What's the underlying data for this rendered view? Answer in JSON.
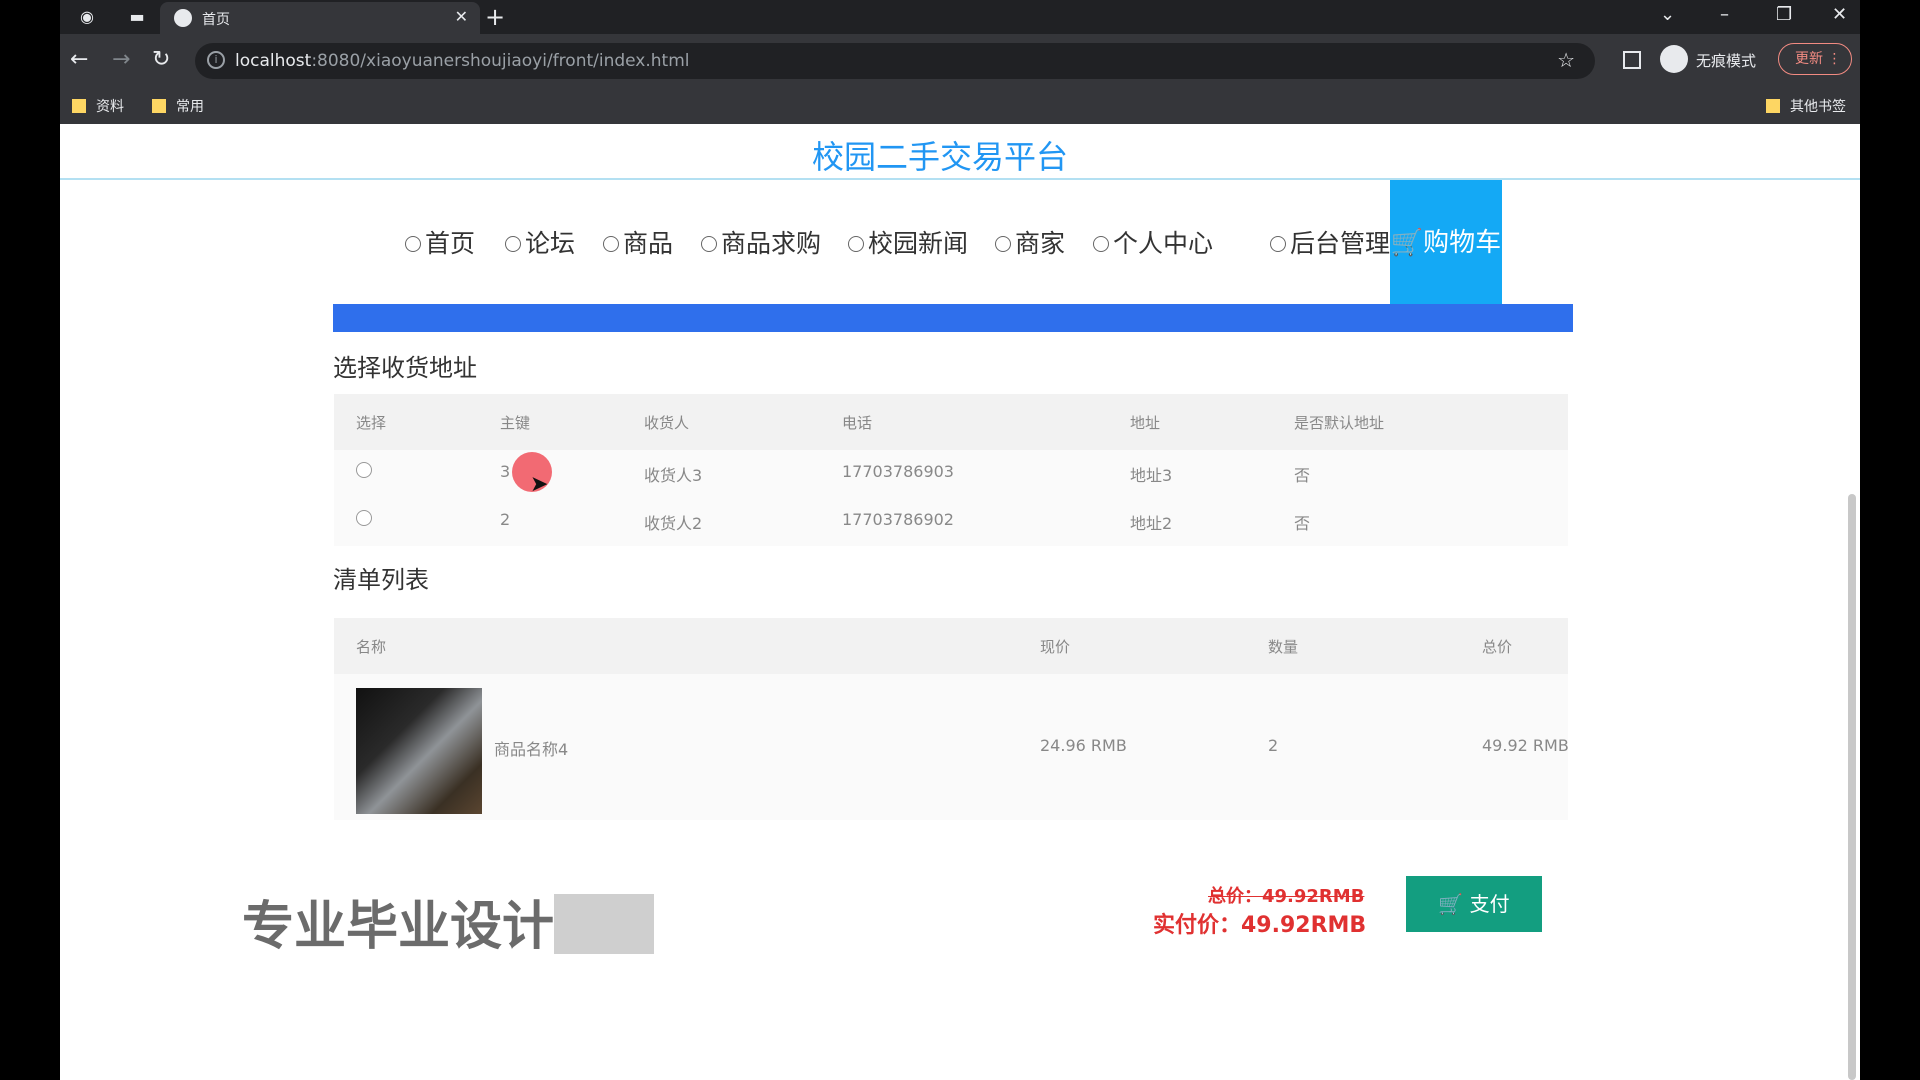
{
  "browser": {
    "tab_title": "首页",
    "url_host": "localhost",
    "url_path": ":8080/xiaoyuanershoujiaoyi/front/index.html",
    "incognito_label": "无痕模式",
    "update_label": "更新",
    "bookmarks": [
      "资料",
      "常用"
    ],
    "other_bookmarks": "其他书签"
  },
  "site": {
    "title": "校园二手交易平台",
    "nav": [
      "首页",
      "论坛",
      "商品",
      "商品求购",
      "校园新闻",
      "商家",
      "个人中心",
      "后台管理"
    ],
    "nav_active": "购物车"
  },
  "address_section": {
    "title": "选择收货地址",
    "headers": [
      "选择",
      "主键",
      "收货人",
      "电话",
      "地址",
      "是否默认地址"
    ],
    "rows": [
      {
        "id": "3",
        "receiver": "收货人3",
        "phone": "17703786903",
        "address": "地址3",
        "default": "否"
      },
      {
        "id": "2",
        "receiver": "收货人2",
        "phone": "17703786902",
        "address": "地址2",
        "default": "否"
      }
    ]
  },
  "order_section": {
    "title": "清单列表",
    "headers": [
      "名称",
      "现价",
      "数量",
      "总价"
    ],
    "rows": [
      {
        "name": "商品名称4",
        "price": "24.96 RMB",
        "qty": "2",
        "total": "49.92 RMB"
      }
    ]
  },
  "summary": {
    "total_label": "总价：49.92RMB",
    "paid_label": "实付价：49.92RMB",
    "pay_button": "支付"
  },
  "watermark": "专业毕业设计",
  "colors": {
    "accent": "#2196f3",
    "cart_active": "#14a9f5",
    "pay": "#139e80",
    "price": "#e03131"
  }
}
